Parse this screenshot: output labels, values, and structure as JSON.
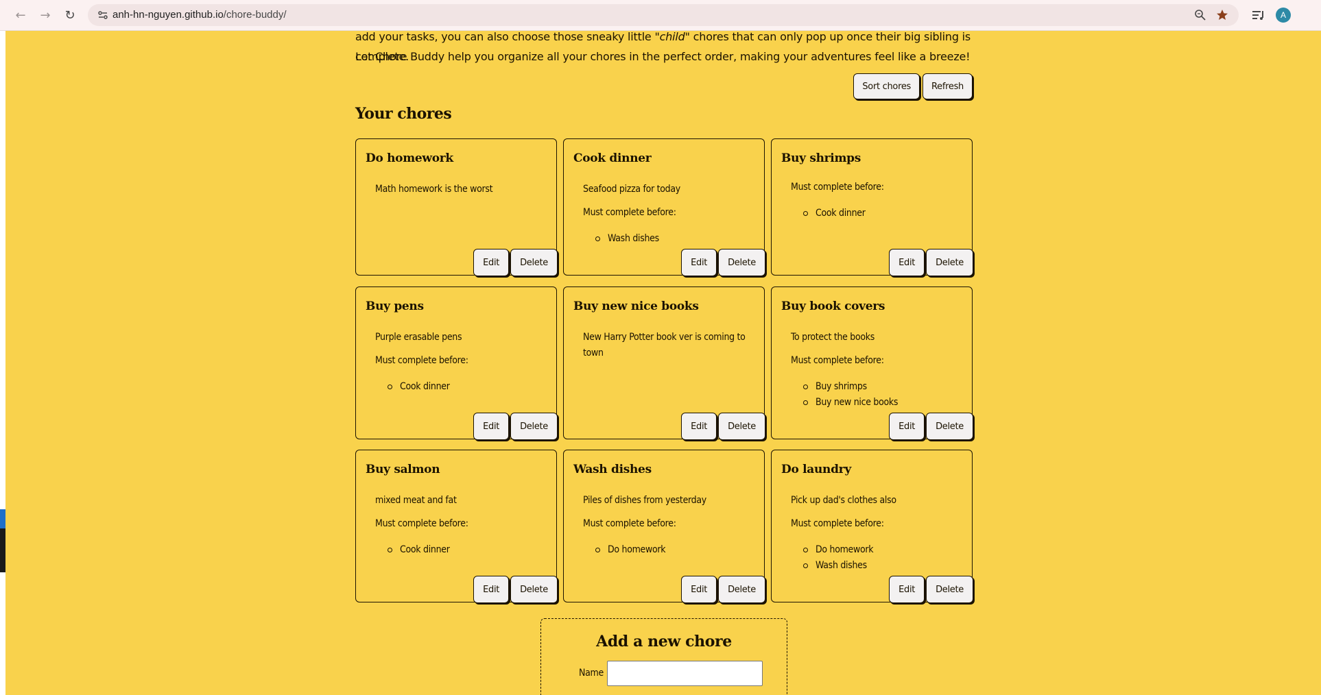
{
  "browser": {
    "url_host": "anh-hn-nguyen.github.io",
    "url_path": "/chore-buddy/",
    "avatar_letter": "A"
  },
  "intro": {
    "line1_before": "add your tasks, you can also choose those sneaky little ",
    "line1_em": "\"child\"",
    "line1_after": " chores that can only pop up once their big sibling is complete.",
    "line2": "Let Chore Buddy help you organize all your chores in the perfect order, making your adventures feel like a breeze!"
  },
  "actions": {
    "sort_label": "Sort chores",
    "refresh_label": "Refresh"
  },
  "section_title": "Your chores",
  "card_labels": {
    "must_complete": "Must complete before:",
    "edit": "Edit",
    "delete": "Delete"
  },
  "chores": [
    {
      "name": "Do homework",
      "description": "Math homework is the worst",
      "before": []
    },
    {
      "name": "Cook dinner",
      "description": "Seafood pizza for today",
      "before": [
        "Wash dishes"
      ]
    },
    {
      "name": "Buy shrimps",
      "description": "",
      "before": [
        "Cook dinner"
      ]
    },
    {
      "name": "Buy pens",
      "description": "Purple erasable pens",
      "before": [
        "Cook dinner"
      ]
    },
    {
      "name": "Buy new nice books",
      "description": "New Harry Potter book ver is coming to town",
      "before": []
    },
    {
      "name": "Buy book covers",
      "description": "To protect the books",
      "before": [
        "Buy shrimps",
        "Buy new nice books"
      ]
    },
    {
      "name": "Buy salmon",
      "description": "mixed meat and fat",
      "before": [
        "Cook dinner"
      ]
    },
    {
      "name": "Wash dishes",
      "description": "Piles of dishes from yesterday",
      "before": [
        "Do homework"
      ]
    },
    {
      "name": "Do laundry",
      "description": "Pick up dad's clothes also",
      "before": [
        "Do homework",
        "Wash dishes"
      ]
    }
  ],
  "add_form": {
    "title": "Add a new chore",
    "name_label": "Name",
    "name_value": ""
  },
  "colors": {
    "page_background": "#f9d24c",
    "ink": "#1b1200",
    "button_background": "#f3f1f1"
  }
}
